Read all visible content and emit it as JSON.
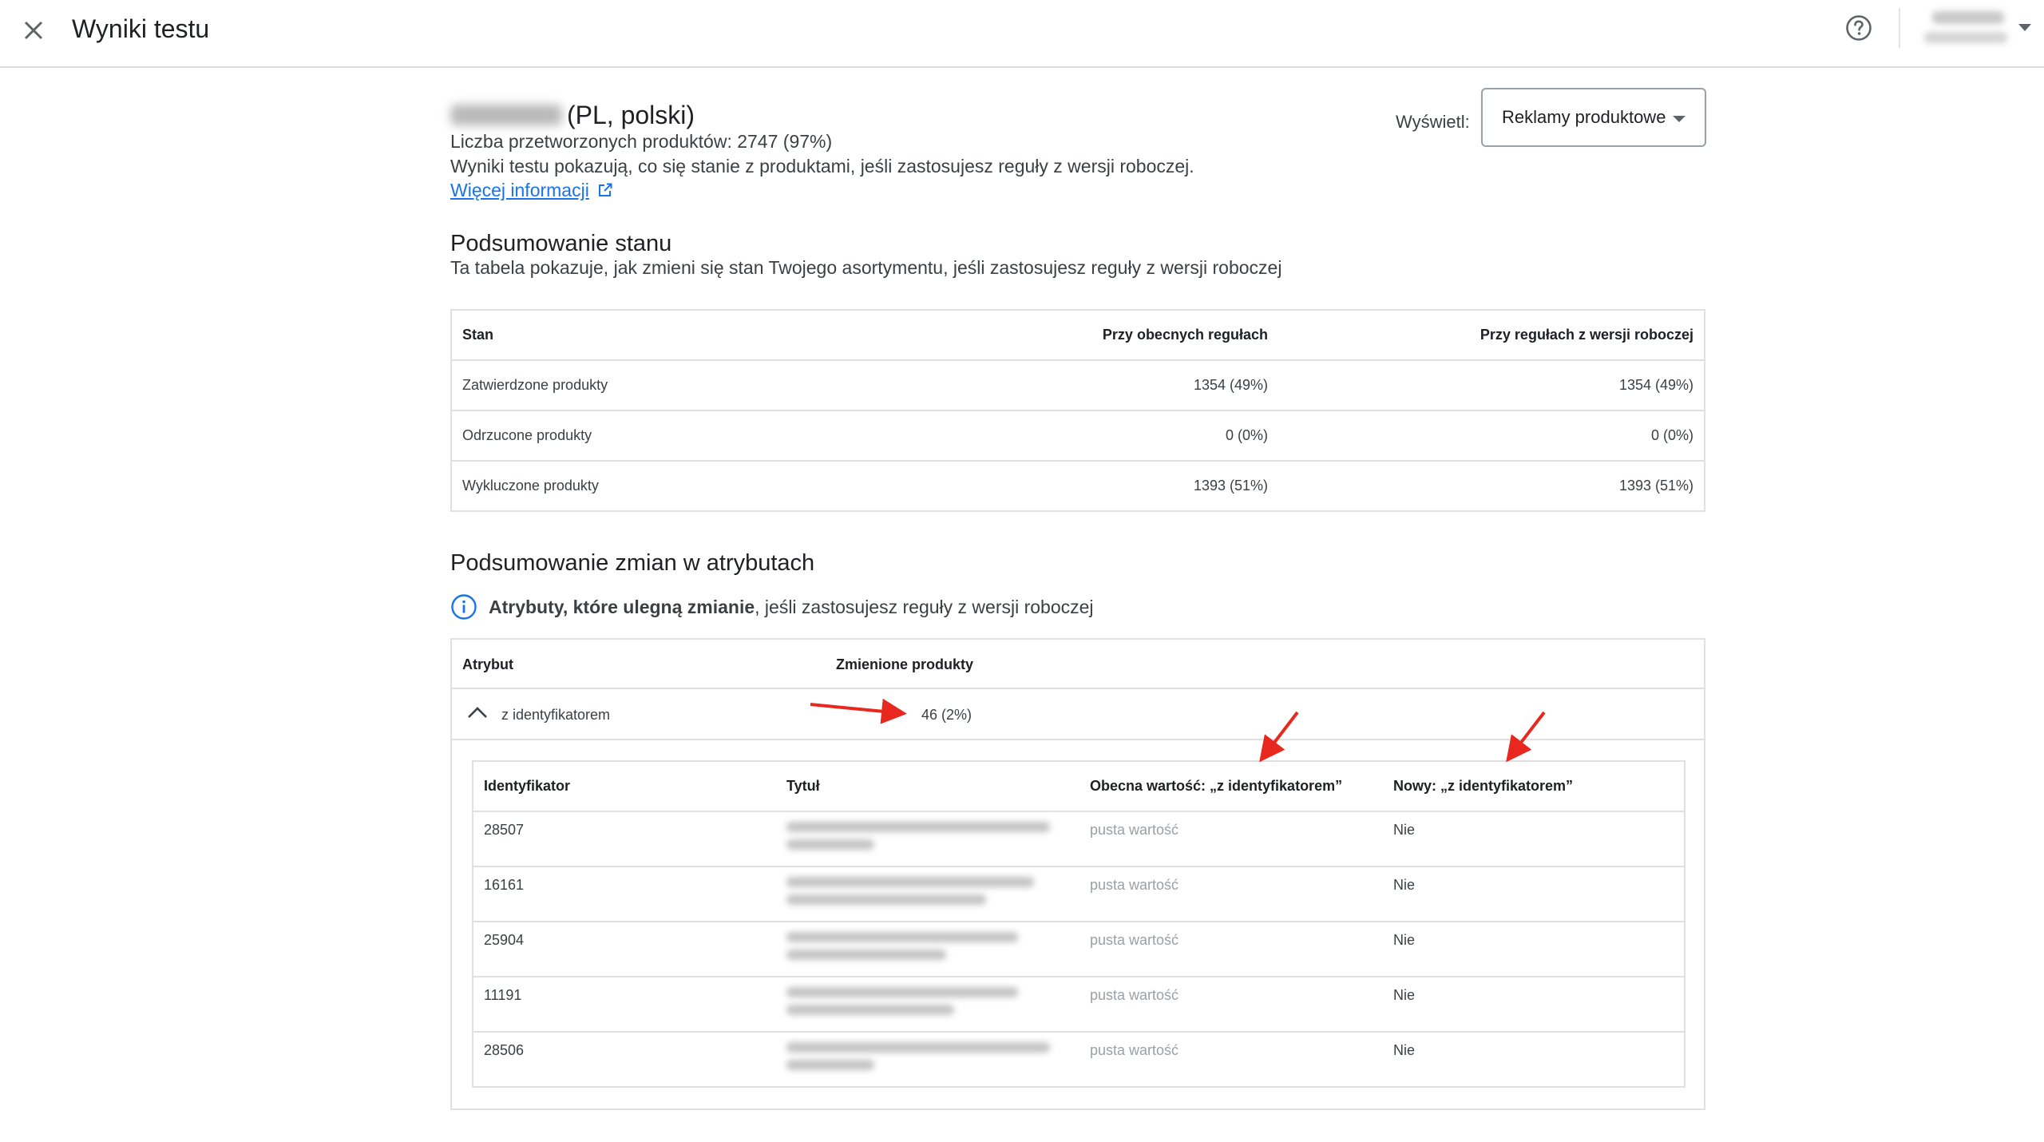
{
  "header": {
    "title": "Wyniki testu",
    "close_icon": "close-icon",
    "help_icon": "help-icon"
  },
  "summary": {
    "store_suffix": "(PL, polski)",
    "processed": "Liczba przetworzonych produktów: 2747 (97%)",
    "description": "Wyniki testu pokazują, co się stanie z produktami, jeśli zastosujesz reguły z wersji roboczej.",
    "more_link": "Więcej informacji"
  },
  "view": {
    "label": "Wyświetl:",
    "selected": "Reklamy produktowe"
  },
  "status": {
    "heading": "Podsumowanie stanu",
    "subheading": "Ta tabela pokazuje, jak zmieni się stan Twojego asortymentu, jeśli zastosujesz reguły z wersji roboczej",
    "columns": [
      "Stan",
      "Przy obecnych regułach",
      "Przy regułach z wersji roboczej"
    ],
    "rows": [
      {
        "label": "Zatwierdzone produkty",
        "current": "1354 (49%)",
        "draft": "1354 (49%)"
      },
      {
        "label": "Odrzucone produkty",
        "current": "0 (0%)",
        "draft": "0 (0%)"
      },
      {
        "label": "Wykluczone produkty",
        "current": "1393 (51%)",
        "draft": "1393 (51%)"
      }
    ]
  },
  "attributes": {
    "heading": "Podsumowanie zmian w atrybutach",
    "info_bold": "Atrybuty, które ulegną zmianie",
    "info_rest": ", jeśli zastosujesz reguły z wersji roboczej",
    "columns": [
      "Atrybut",
      "Zmienione produkty"
    ],
    "row": {
      "name": "z identyfikatorem",
      "count": "46 (2%)"
    },
    "details": {
      "columns": [
        "Identyfikator",
        "Tytuł",
        "Obecna wartość: „z identyfikatorem”",
        "Nowy: „z identyfikatorem”"
      ],
      "rows": [
        {
          "id": "28507",
          "current": "pusta wartość",
          "new": "Nie"
        },
        {
          "id": "16161",
          "current": "pusta wartość",
          "new": "Nie"
        },
        {
          "id": "25904",
          "current": "pusta wartość",
          "new": "Nie"
        },
        {
          "id": "11191",
          "current": "pusta wartość",
          "new": "Nie"
        },
        {
          "id": "28506",
          "current": "pusta wartość",
          "new": "Nie"
        }
      ]
    }
  },
  "colors": {
    "link": "#1a73e8",
    "annotation_arrow": "#e8281e",
    "border": "#e0e0e0"
  }
}
